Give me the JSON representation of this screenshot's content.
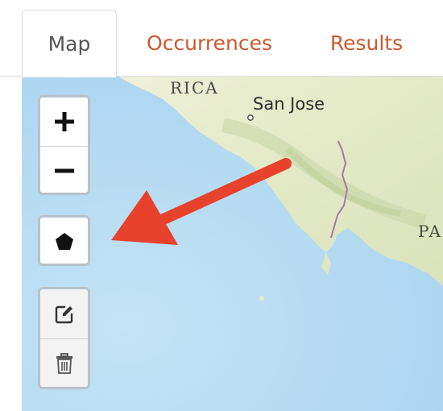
{
  "tabs": [
    {
      "label": "Map",
      "active": true
    },
    {
      "label": "Occurrences",
      "active": false
    },
    {
      "label": "Results",
      "active": false
    }
  ],
  "map": {
    "labels": {
      "rica": "RICA",
      "san_jose": "San Jose",
      "pa": "PA"
    },
    "colors": {
      "water": "#b8dcf1",
      "land": "#e7ecd0",
      "border": "#a679a8"
    }
  },
  "controls": {
    "zoom_in_icon": "plus-icon",
    "zoom_out_icon": "minus-icon",
    "draw_polygon_icon": "pentagon-icon",
    "edit_icon": "edit-icon",
    "delete_icon": "trash-icon"
  },
  "annotation": {
    "arrow_color": "#e8412c"
  },
  "colors": {
    "tab_active_text": "#555555",
    "tab_inactive_text": "#c95a2e"
  }
}
